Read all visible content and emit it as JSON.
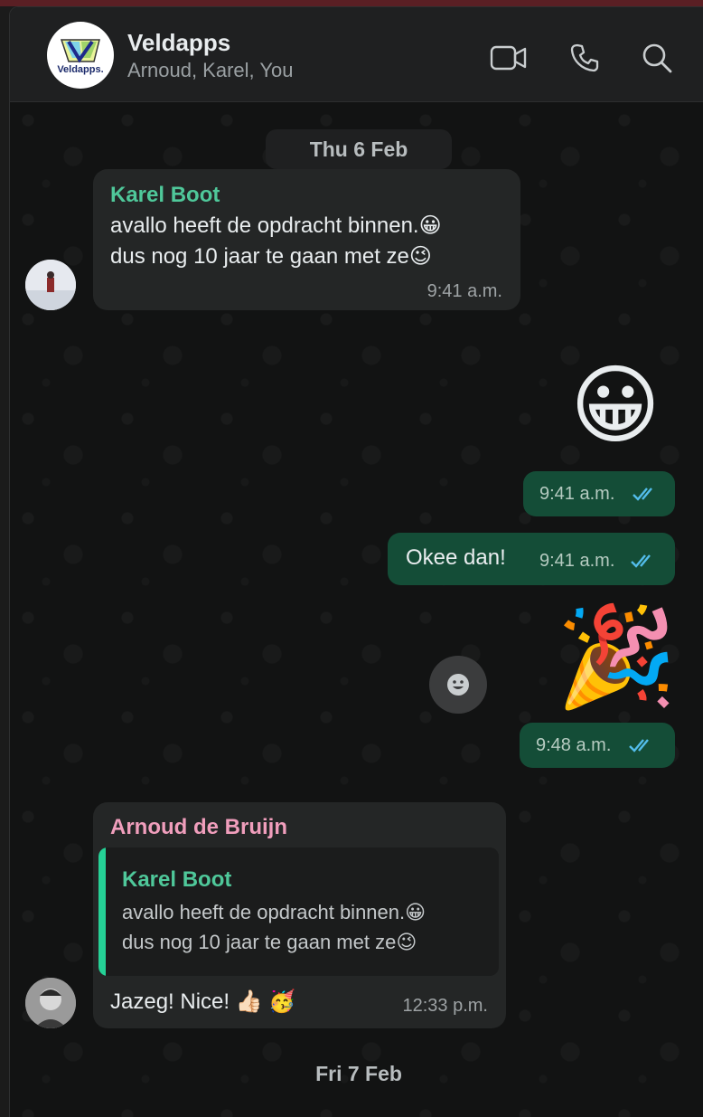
{
  "header": {
    "title": "Veldapps",
    "subtitle": "Arnoud, Karel, You",
    "logo_text": "Veldapps.",
    "icons": [
      "video-call-icon",
      "voice-call-icon",
      "search-icon"
    ]
  },
  "chat": {
    "date_separators": [
      "Thu 6 Feb",
      "Fri 7 Feb"
    ],
    "messages": [
      {
        "sender": "Karel Boot",
        "sender_color": "#4fc89a",
        "line1": "avallo heeft de opdracht binnen.",
        "line1_emoji": "😀",
        "line2": "dus nog 10 jaar te gaan met ze",
        "line2_emoji": "😉",
        "time": "9:41 a.m."
      },
      {
        "type": "emoji",
        "emoji": "😀",
        "time": "9:41 a.m.",
        "status": "read"
      },
      {
        "text": "Okee dan!",
        "time": "9:41 a.m.",
        "status": "read"
      },
      {
        "type": "emoji",
        "emoji": "🎉",
        "time": "9:48 a.m.",
        "status": "read"
      },
      {
        "sender": "Arnoud de Bruijn",
        "sender_color": "#f09ebc",
        "quote": {
          "sender": "Karel Boot",
          "line1": "avallo heeft de opdracht binnen.",
          "line1_emoji": "😀",
          "line2": "dus nog 10 jaar te gaan met ze",
          "line2_emoji": "😉"
        },
        "text": "Jazeg! Nice!",
        "emojis": "👍🏻 🥳",
        "time": "12:33 p.m."
      }
    ]
  },
  "colors": {
    "outgoing_bubble": "#144d37",
    "incoming_bubble": "#242626",
    "read_ticks": "#53bdeb"
  }
}
